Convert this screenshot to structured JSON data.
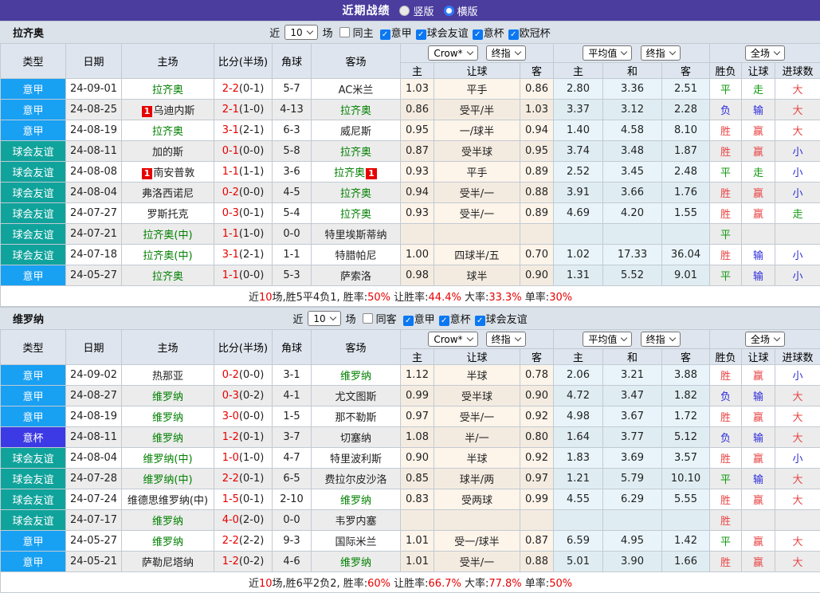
{
  "title_bar": {
    "title": "近期战绩",
    "vertical_label": "竖版",
    "horizontal_label": "横版"
  },
  "table_header": {
    "static": [
      "类型",
      "日期",
      "主场",
      "比分(半场)",
      "角球",
      "客场"
    ],
    "odds_source": "Crow*",
    "final_label": "终指",
    "average_label": "平均值",
    "average_final_label": "终指",
    "scope_label": "全场",
    "sub": [
      "主",
      "让球",
      "客",
      "主",
      "和",
      "客",
      "胜负",
      "让球",
      "进球数"
    ]
  },
  "type_colors": {
    "意甲": "#18a0f3",
    "球会友谊": "#10a39c",
    "意杯": "#3c3ae4"
  },
  "palette": {
    "title_bar": "#4a3d9e",
    "header_bg": "#dee5ee",
    "checkbox_blue": "#0b78f2",
    "team_green": "#008000",
    "score_red": "#e60000",
    "win_red": "#e84545",
    "loss_blue": "#2b2bdb",
    "draw_green": "#0f9a0f",
    "odds_col_bg": "#fdf4ea",
    "avg_col_bg": "#e8f4fa"
  },
  "sections": [
    {
      "team": "拉齐奥",
      "filter": {
        "near_label": "近",
        "count": "10",
        "games_label": "场",
        "same_label": "同主",
        "same_checked": false,
        "leagues": [
          "意甲",
          "球会友谊",
          "意杯",
          "欧冠杯"
        ]
      },
      "rows": [
        {
          "type": "意甲",
          "date": "24-09-01",
          "home": {
            "name": "拉齐奥",
            "green": true
          },
          "score": "2-2",
          "half": "(0-1)",
          "corner": "5-7",
          "away": {
            "name": "AC米兰"
          },
          "odds": [
            "1.03",
            "平手",
            "0.86"
          ],
          "avg": [
            "2.80",
            "3.36",
            "2.51"
          ],
          "res": [
            [
              "平",
              "d"
            ],
            [
              "走",
              "d"
            ],
            [
              "大",
              "w"
            ]
          ]
        },
        {
          "type": "意甲",
          "date": "24-08-25",
          "home": {
            "name": "乌迪内斯",
            "card": "1"
          },
          "score": "2-1",
          "half": "(1-0)",
          "corner": "4-13",
          "away": {
            "name": "拉齐奥",
            "green": true
          },
          "odds": [
            "0.86",
            "受平/半",
            "1.03"
          ],
          "avg": [
            "3.37",
            "3.12",
            "2.28"
          ],
          "res": [
            [
              "负",
              "l"
            ],
            [
              "输",
              "l"
            ],
            [
              "大",
              "w"
            ]
          ]
        },
        {
          "type": "意甲",
          "date": "24-08-19",
          "home": {
            "name": "拉齐奥",
            "green": true
          },
          "score": "3-1",
          "half": "(2-1)",
          "corner": "6-3",
          "away": {
            "name": "威尼斯"
          },
          "odds": [
            "0.95",
            "一/球半",
            "0.94"
          ],
          "avg": [
            "1.40",
            "4.58",
            "8.10"
          ],
          "res": [
            [
              "胜",
              "w"
            ],
            [
              "赢",
              "w"
            ],
            [
              "大",
              "w"
            ]
          ]
        },
        {
          "type": "球会友谊",
          "date": "24-08-11",
          "home": {
            "name": "加的斯"
          },
          "score": "0-1",
          "half": "(0-0)",
          "corner": "5-8",
          "away": {
            "name": "拉齐奥",
            "green": true
          },
          "odds": [
            "0.87",
            "受半球",
            "0.95"
          ],
          "avg": [
            "3.74",
            "3.48",
            "1.87"
          ],
          "res": [
            [
              "胜",
              "w"
            ],
            [
              "赢",
              "w"
            ],
            [
              "小",
              "l"
            ]
          ]
        },
        {
          "type": "球会友谊",
          "date": "24-08-08",
          "home": {
            "name": "南安普敦",
            "card": "1"
          },
          "score": "1-1",
          "half": "(1-1)",
          "corner": "3-6",
          "away": {
            "name": "拉齐奥",
            "green": true,
            "card": "1"
          },
          "odds": [
            "0.93",
            "平手",
            "0.89"
          ],
          "avg": [
            "2.52",
            "3.45",
            "2.48"
          ],
          "res": [
            [
              "平",
              "d"
            ],
            [
              "走",
              "d"
            ],
            [
              "小",
              "l"
            ]
          ]
        },
        {
          "type": "球会友谊",
          "date": "24-08-04",
          "home": {
            "name": "弗洛西诺尼"
          },
          "score": "0-2",
          "half": "(0-0)",
          "corner": "4-5",
          "away": {
            "name": "拉齐奥",
            "green": true
          },
          "odds": [
            "0.94",
            "受半/一",
            "0.88"
          ],
          "avg": [
            "3.91",
            "3.66",
            "1.76"
          ],
          "res": [
            [
              "胜",
              "w"
            ],
            [
              "赢",
              "w"
            ],
            [
              "小",
              "l"
            ]
          ]
        },
        {
          "type": "球会友谊",
          "date": "24-07-27",
          "home": {
            "name": "罗斯托克"
          },
          "score": "0-3",
          "half": "(0-1)",
          "corner": "5-4",
          "away": {
            "name": "拉齐奥",
            "green": true
          },
          "odds": [
            "0.93",
            "受半/一",
            "0.89"
          ],
          "avg": [
            "4.69",
            "4.20",
            "1.55"
          ],
          "res": [
            [
              "胜",
              "w"
            ],
            [
              "赢",
              "w"
            ],
            [
              "走",
              "d"
            ]
          ]
        },
        {
          "type": "球会友谊",
          "date": "24-07-21",
          "home": {
            "name": "拉齐奥(中)",
            "green": true
          },
          "score": "1-1",
          "half": "(1-0)",
          "corner": "0-0",
          "away": {
            "name": "特里埃斯蒂纳"
          },
          "odds": [
            "",
            "",
            ""
          ],
          "avg": [
            "",
            "",
            ""
          ],
          "res": [
            [
              "平",
              "d"
            ],
            [
              "",
              ""
            ],
            [
              "",
              ""
            ]
          ]
        },
        {
          "type": "球会友谊",
          "date": "24-07-18",
          "home": {
            "name": "拉齐奥(中)",
            "green": true
          },
          "score": "3-1",
          "half": "(2-1)",
          "corner": "1-1",
          "away": {
            "name": "特腊帕尼"
          },
          "odds": [
            "1.00",
            "四球半/五",
            "0.70"
          ],
          "avg": [
            "1.02",
            "17.33",
            "36.04"
          ],
          "res": [
            [
              "胜",
              "w"
            ],
            [
              "输",
              "l"
            ],
            [
              "小",
              "l"
            ]
          ]
        },
        {
          "type": "意甲",
          "date": "24-05-27",
          "home": {
            "name": "拉齐奥",
            "green": true
          },
          "score": "1-1",
          "half": "(0-0)",
          "corner": "5-3",
          "away": {
            "name": "萨索洛"
          },
          "odds": [
            "0.98",
            "球半",
            "0.90"
          ],
          "avg": [
            "1.31",
            "5.52",
            "9.01"
          ],
          "res": [
            [
              "平",
              "d"
            ],
            [
              "输",
              "l"
            ],
            [
              "小",
              "l"
            ]
          ]
        }
      ],
      "summary": [
        [
          "近",
          false
        ],
        [
          "10",
          true
        ],
        [
          "场,胜5平4负1, 胜率:",
          false
        ],
        [
          "50%",
          true
        ],
        [
          " 让胜率:",
          false
        ],
        [
          "44.4%",
          true
        ],
        [
          " 大率:",
          false
        ],
        [
          "33.3%",
          true
        ],
        [
          " 单率:",
          false
        ],
        [
          "30%",
          true
        ]
      ]
    },
    {
      "team": "维罗纳",
      "filter": {
        "near_label": "近",
        "count": "10",
        "games_label": "场",
        "same_label": "同客",
        "same_checked": false,
        "leagues": [
          "意甲",
          "意杯",
          "球会友谊"
        ]
      },
      "rows": [
        {
          "type": "意甲",
          "date": "24-09-02",
          "home": {
            "name": "热那亚"
          },
          "score": "0-2",
          "half": "(0-0)",
          "corner": "3-1",
          "away": {
            "name": "维罗纳",
            "green": true
          },
          "odds": [
            "1.12",
            "半球",
            "0.78"
          ],
          "avg": [
            "2.06",
            "3.21",
            "3.88"
          ],
          "res": [
            [
              "胜",
              "w"
            ],
            [
              "赢",
              "w"
            ],
            [
              "小",
              "l"
            ]
          ]
        },
        {
          "type": "意甲",
          "date": "24-08-27",
          "home": {
            "name": "维罗纳",
            "green": true
          },
          "score": "0-3",
          "half": "(0-2)",
          "corner": "4-1",
          "away": {
            "name": "尤文图斯"
          },
          "odds": [
            "0.99",
            "受半球",
            "0.90"
          ],
          "avg": [
            "4.72",
            "3.47",
            "1.82"
          ],
          "res": [
            [
              "负",
              "l"
            ],
            [
              "输",
              "l"
            ],
            [
              "大",
              "w"
            ]
          ]
        },
        {
          "type": "意甲",
          "date": "24-08-19",
          "home": {
            "name": "维罗纳",
            "green": true
          },
          "score": "3-0",
          "half": "(0-0)",
          "corner": "1-5",
          "away": {
            "name": "那不勒斯"
          },
          "odds": [
            "0.97",
            "受半/一",
            "0.92"
          ],
          "avg": [
            "4.98",
            "3.67",
            "1.72"
          ],
          "res": [
            [
              "胜",
              "w"
            ],
            [
              "赢",
              "w"
            ],
            [
              "大",
              "w"
            ]
          ]
        },
        {
          "type": "意杯",
          "date": "24-08-11",
          "home": {
            "name": "维罗纳",
            "green": true
          },
          "score": "1-2",
          "half": "(0-1)",
          "corner": "3-7",
          "away": {
            "name": "切塞纳"
          },
          "odds": [
            "1.08",
            "半/一",
            "0.80"
          ],
          "avg": [
            "1.64",
            "3.77",
            "5.12"
          ],
          "res": [
            [
              "负",
              "l"
            ],
            [
              "输",
              "l"
            ],
            [
              "大",
              "w"
            ]
          ]
        },
        {
          "type": "球会友谊",
          "date": "24-08-04",
          "home": {
            "name": "维罗纳(中)",
            "green": true
          },
          "score": "1-0",
          "half": "(1-0)",
          "corner": "4-7",
          "away": {
            "name": "特里波利斯"
          },
          "odds": [
            "0.90",
            "半球",
            "0.92"
          ],
          "avg": [
            "1.83",
            "3.69",
            "3.57"
          ],
          "res": [
            [
              "胜",
              "w"
            ],
            [
              "赢",
              "w"
            ],
            [
              "小",
              "l"
            ]
          ]
        },
        {
          "type": "球会友谊",
          "date": "24-07-28",
          "home": {
            "name": "维罗纳(中)",
            "green": true
          },
          "score": "2-2",
          "half": "(0-1)",
          "corner": "6-5",
          "away": {
            "name": "费拉尔皮沙洛"
          },
          "odds": [
            "0.85",
            "球半/两",
            "0.97"
          ],
          "avg": [
            "1.21",
            "5.79",
            "10.10"
          ],
          "res": [
            [
              "平",
              "d"
            ],
            [
              "输",
              "l"
            ],
            [
              "大",
              "w"
            ]
          ]
        },
        {
          "type": "球会友谊",
          "date": "24-07-24",
          "home": {
            "name": "维德思维罗纳(中)"
          },
          "score": "1-5",
          "half": "(0-1)",
          "corner": "2-10",
          "away": {
            "name": "维罗纳",
            "green": true
          },
          "odds": [
            "0.83",
            "受两球",
            "0.99"
          ],
          "avg": [
            "4.55",
            "6.29",
            "5.55"
          ],
          "res": [
            [
              "胜",
              "w"
            ],
            [
              "赢",
              "w"
            ],
            [
              "大",
              "w"
            ]
          ]
        },
        {
          "type": "球会友谊",
          "date": "24-07-17",
          "home": {
            "name": "维罗纳",
            "green": true
          },
          "score": "4-0",
          "half": "(2-0)",
          "corner": "0-0",
          "away": {
            "name": "韦罗内塞"
          },
          "odds": [
            "",
            "",
            ""
          ],
          "avg": [
            "",
            "",
            ""
          ],
          "res": [
            [
              "胜",
              "w"
            ],
            [
              "",
              ""
            ],
            [
              "",
              ""
            ]
          ]
        },
        {
          "type": "意甲",
          "date": "24-05-27",
          "home": {
            "name": "维罗纳",
            "green": true
          },
          "score": "2-2",
          "half": "(2-2)",
          "corner": "9-3",
          "away": {
            "name": "国际米兰"
          },
          "odds": [
            "1.01",
            "受一/球半",
            "0.87"
          ],
          "avg": [
            "6.59",
            "4.95",
            "1.42"
          ],
          "res": [
            [
              "平",
              "d"
            ],
            [
              "赢",
              "w"
            ],
            [
              "大",
              "w"
            ]
          ]
        },
        {
          "type": "意甲",
          "date": "24-05-21",
          "home": {
            "name": "萨勒尼塔纳"
          },
          "score": "1-2",
          "half": "(0-2)",
          "corner": "4-6",
          "away": {
            "name": "维罗纳",
            "green": true
          },
          "odds": [
            "1.01",
            "受半/一",
            "0.88"
          ],
          "avg": [
            "5.01",
            "3.90",
            "1.66"
          ],
          "res": [
            [
              "胜",
              "w"
            ],
            [
              "赢",
              "w"
            ],
            [
              "大",
              "w"
            ]
          ]
        }
      ],
      "summary": [
        [
          "近",
          false
        ],
        [
          "10",
          true
        ],
        [
          "场,胜6平2负2, 胜率:",
          false
        ],
        [
          "60%",
          true
        ],
        [
          " 让胜率:",
          false
        ],
        [
          "66.7%",
          true
        ],
        [
          " 大率:",
          false
        ],
        [
          "77.8%",
          true
        ],
        [
          " 单率:",
          false
        ],
        [
          "50%",
          true
        ]
      ]
    }
  ]
}
